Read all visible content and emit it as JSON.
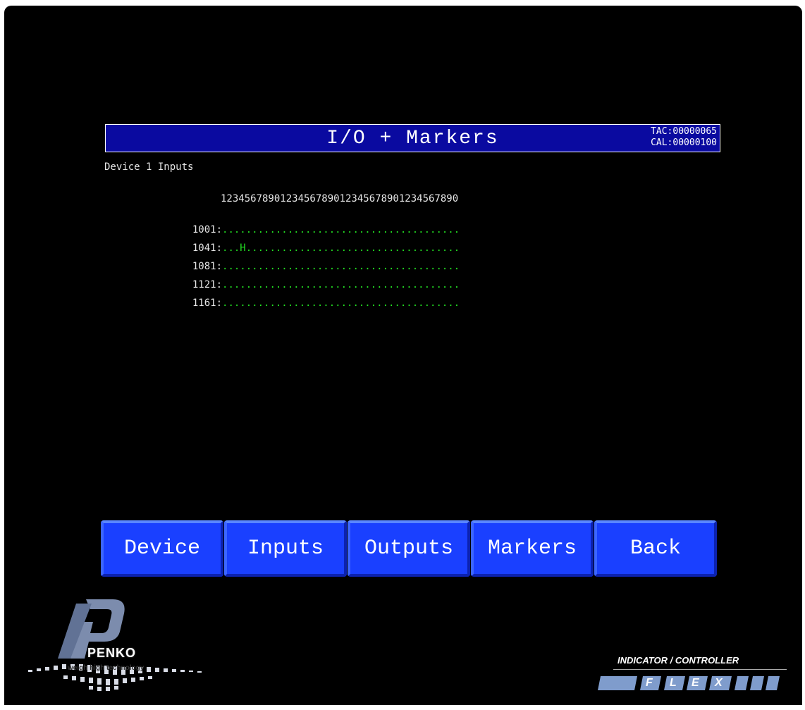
{
  "header": {
    "title": "I/O + Markers",
    "tac": "TAC:00000065",
    "cal": "CAL:00000100"
  },
  "section_label": "Device 1 Inputs",
  "ruler": "1234567890123456789012345678901234567890",
  "rows": [
    {
      "addr": "1001:",
      "bits": "........................................"
    },
    {
      "addr": "1041:",
      "bits": "...H...................................."
    },
    {
      "addr": "1081:",
      "bits": "........................................"
    },
    {
      "addr": "1121:",
      "bits": "........................................"
    },
    {
      "addr": "1161:",
      "bits": "........................................"
    }
  ],
  "buttons": {
    "device": "Device",
    "inputs": "Inputs",
    "outputs": "Outputs",
    "markers": "Markers",
    "back": "Back"
  },
  "branding": {
    "company": "PENKO",
    "tagline": "weigh high technology",
    "product_caption": "INDICATOR / CONTROLLER",
    "product_letters": [
      "F",
      "L",
      "E",
      "X"
    ]
  },
  "colors": {
    "background": "#000000",
    "title_bar": "#0a0aa0",
    "button": "#1a40ff",
    "bit_color": "#22dd22"
  }
}
